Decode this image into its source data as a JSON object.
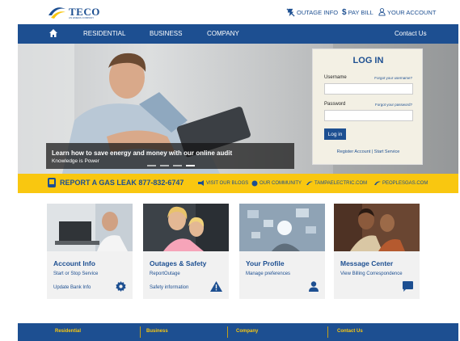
{
  "brand": {
    "name": "TECO",
    "tagline": "AN EMERA COMPANY",
    "blue": "#1d4f91",
    "yellow": "#f9c710"
  },
  "utility": {
    "outage": "OUTAGE INFO",
    "pay": "PAY BILL",
    "account": "YOUR ACCOUNT"
  },
  "nav": {
    "items": [
      "RESIDENTIAL",
      "BUSINESS",
      "COMPANY"
    ],
    "contact": "Contact Us"
  },
  "hero": {
    "headline": "Learn how to save energy and money with our online audit",
    "subline": "Knowledge is Power",
    "slides": 4,
    "active_slide": 4
  },
  "login": {
    "title": "LOG IN",
    "username_label": "Username",
    "forgot_username": "Forgot your username?",
    "password_label": "Password",
    "forgot_password": "Forgot your password?",
    "button": "Log in",
    "register": "Register Account | Start Service"
  },
  "alert": {
    "gas_leak": "REPORT A GAS LEAK 877-832-6747",
    "links": [
      "VISIT OUR BLOGS",
      "OUR COMMUNITY",
      "TAMPAELECTRIC.COM",
      "PEOPLESGAS.COM"
    ]
  },
  "cards": [
    {
      "title": "Account Info",
      "link1": "Start or Stop Service",
      "link2": "Update Bank Info",
      "icon": "gear-icon"
    },
    {
      "title": "Outages & Safety",
      "link1": "ReportOutage",
      "link2": "Safety information",
      "icon": "warning-icon"
    },
    {
      "title": "Your Profile",
      "link1": "Manage preferences",
      "link2": "",
      "icon": "user-icon"
    },
    {
      "title": "Message Center",
      "link1": "View Billing Correspondence",
      "link2": "",
      "icon": "chat-icon"
    }
  ],
  "footer": {
    "items": [
      "Residential",
      "Business",
      "Company",
      "Contact Us"
    ]
  }
}
